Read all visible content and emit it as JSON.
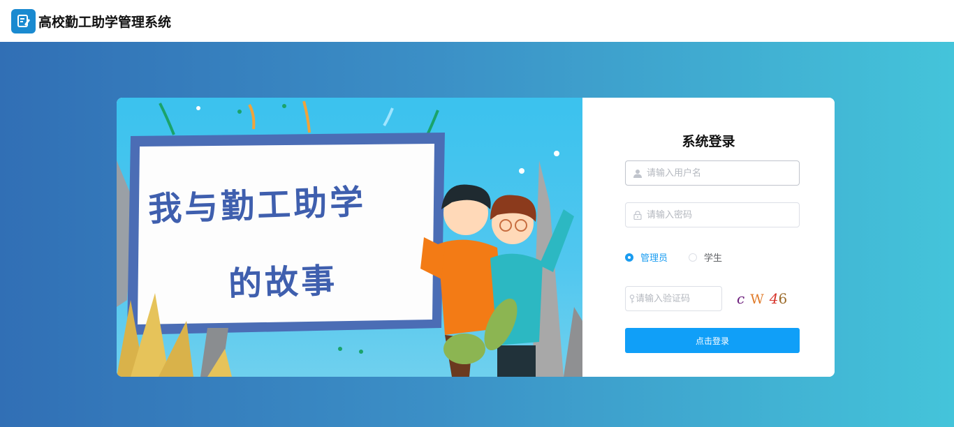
{
  "header": {
    "app_title": "高校勤工助学管理系统",
    "logo_icon": "edit-note-icon",
    "brand_color": "#1a8ad0"
  },
  "banner": {
    "line1": "我与勤工助学",
    "line2": "的故事"
  },
  "login": {
    "title": "系统登录",
    "username_placeholder": "请输入用户名",
    "password_placeholder": "请输入密码",
    "roles": [
      {
        "label": "管理员",
        "checked": true
      },
      {
        "label": "学生",
        "checked": false
      }
    ],
    "captcha_placeholder": "请输入验证码",
    "captcha_chars": [
      "c",
      "W",
      "4",
      "6"
    ],
    "submit_label": "点击登录",
    "accent_color": "#109ff8"
  }
}
